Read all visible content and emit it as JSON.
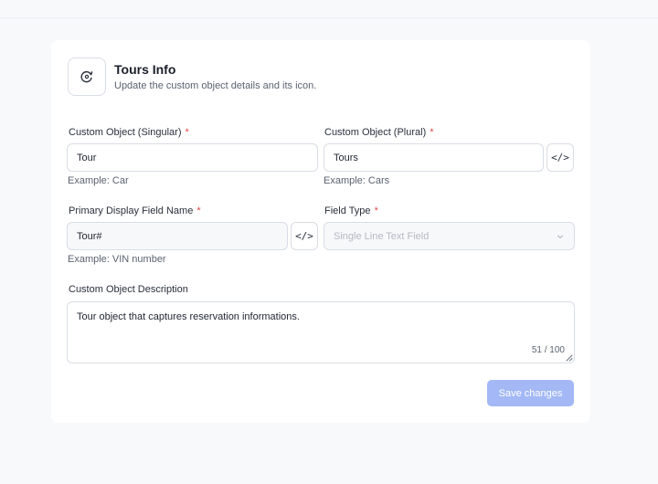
{
  "header": {
    "title": "Tours Info",
    "subtitle": "Update the custom object details and its icon."
  },
  "fields": {
    "singular": {
      "label": "Custom Object (Singular)",
      "required": "*",
      "value": "Tour",
      "hint": "Example: Car"
    },
    "plural": {
      "label": "Custom Object (Plural)",
      "required": "*",
      "value": "Tours",
      "hint": "Example: Cars"
    },
    "primary": {
      "label": "Primary Display Field Name",
      "required": "*",
      "value": "Tour#",
      "hint": "Example: VIN number"
    },
    "field_type": {
      "label": "Field Type",
      "required": "*",
      "selected": "Single Line Text Field"
    },
    "description": {
      "label": "Custom Object Description",
      "value": "Tour object that captures reservation informations.",
      "counter": "51 / 100"
    }
  },
  "code_button_glyph": "</>",
  "save_label": "Save changes",
  "colors": {
    "save_button": "#a3b8f5",
    "required": "#e04848"
  }
}
